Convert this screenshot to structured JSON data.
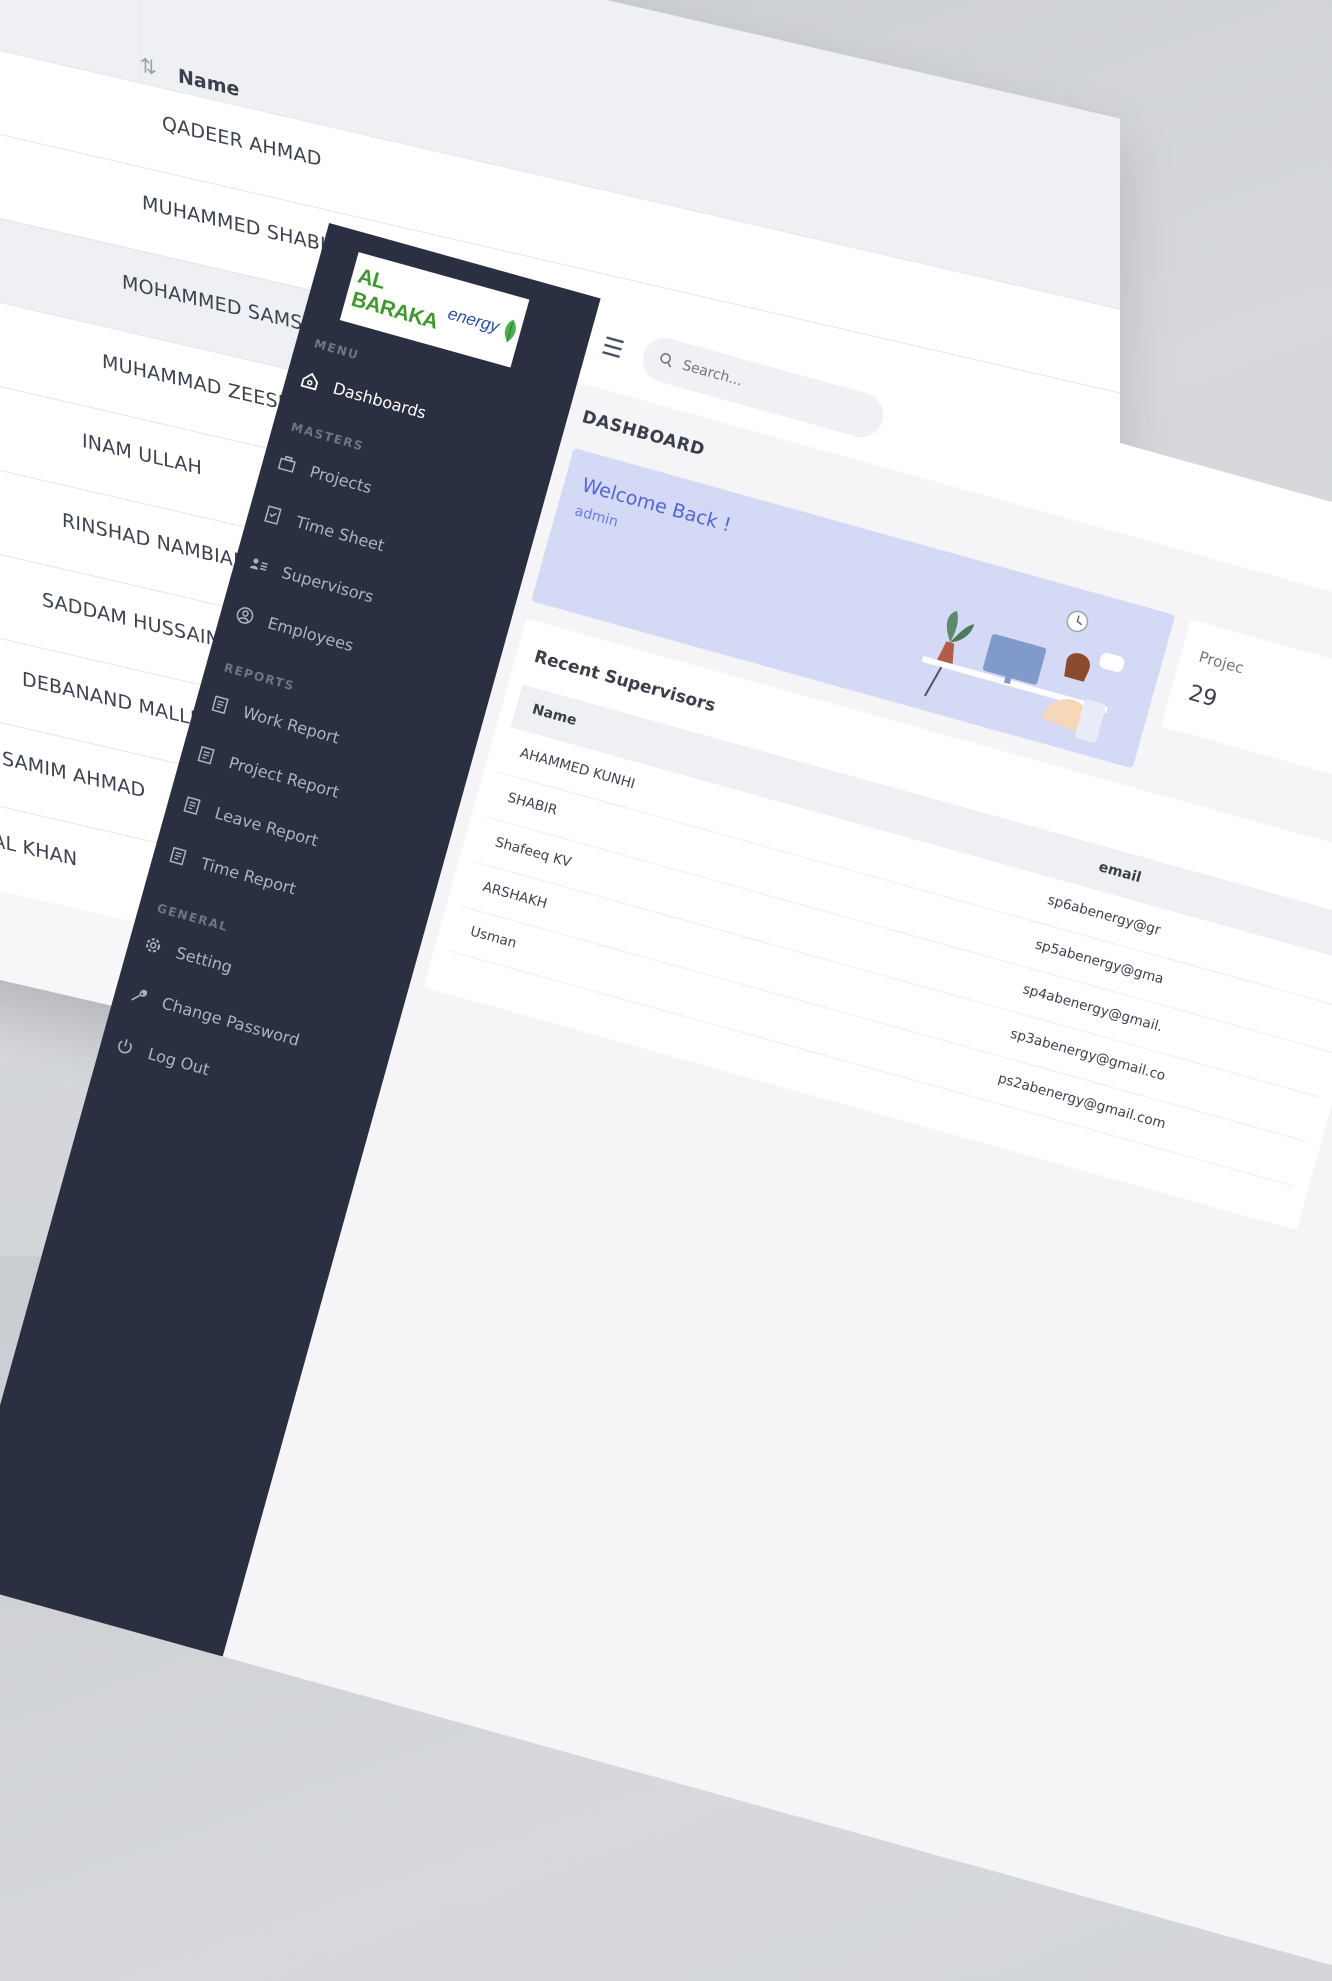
{
  "back_table": {
    "name_header": "Name",
    "sort_icon": "sort-icon",
    "rows": [
      "QADEER AHMAD",
      "MUHAMMED SHABIR",
      "MOHAMMED SAMSHUL ALAM",
      "MUHAMMAD ZEESHAN  KHAN GUL",
      "INAM ULLAH",
      "RINSHAD NAMBIARUV",
      "SADDAM HUSSAIN",
      "DEBANAND MALLICK",
      "SAMIM AHMAD",
      "TAL KHAN"
    ]
  },
  "logo": {
    "text": "AL BARAKA",
    "text2": "energy"
  },
  "sidebar": {
    "menu_label": "MENU",
    "dashboards": "Dashboards",
    "masters_label": "MASTERS",
    "projects": "Projects",
    "timesheet": "Time Sheet",
    "supervisors": "Supervisors",
    "employees": "Employees",
    "reports_label": "REPORTS",
    "work_report": "Work Report",
    "project_report": "Project Report",
    "leave_report": "Leave Report",
    "time_report": "Time Report",
    "general_label": "GENERAL",
    "setting": "Setting",
    "change_password": "Change Password",
    "logout": "Log Out"
  },
  "topbar": {
    "search_placeholder": "Search..."
  },
  "dashboard": {
    "title": "DASHBOARD",
    "welcome_title": "Welcome Back !",
    "welcome_user": "admin",
    "projects_label": "Projec",
    "projects_value": "29",
    "recent_title": "Recent Supervisors",
    "col_name": "Name",
    "col_email": "email",
    "supervisors": [
      {
        "name": "AHAMMED KUNHI",
        "email": "sp6abenergy@gr"
      },
      {
        "name": "SHABIR",
        "email": "sp5abenergy@gma"
      },
      {
        "name": "Shafeeq KV",
        "email": "sp4abenergy@gmail."
      },
      {
        "name": "ARSHAKH",
        "email": "sp3abenergy@gmail.co"
      },
      {
        "name": "Usman",
        "email": "ps2abenergy@gmail.com"
      }
    ]
  },
  "colors": {
    "sidebar": "#2a2f41",
    "accent": "#5465d6",
    "welcome_bg": "#d4daf6"
  }
}
